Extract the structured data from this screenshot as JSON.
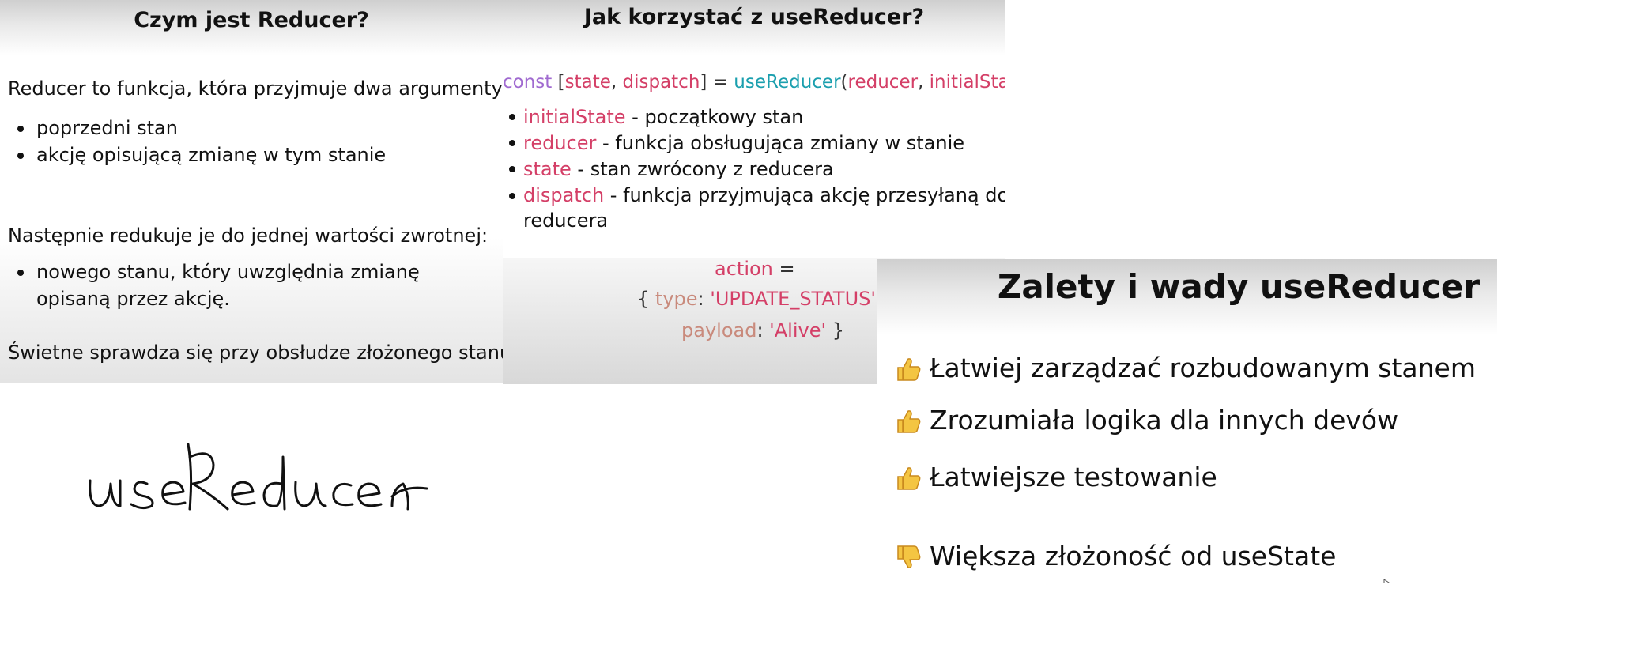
{
  "slide1": {
    "title": "Czym jest Reducer?",
    "intro": "Reducer to funkcja, która przyjmuje dwa argumenty:",
    "args": [
      "poprzedni stan",
      "akcję opisującą zmianę w tym stanie"
    ],
    "then": "Następnie redukuje je do jednej wartości zwrotnej:",
    "result_line1": "nowego stanu, który uwzględnia zmianę",
    "result_line2": "opisaną przez akcję.",
    "closing": "Świetne sprawdza się przy obsłudze złożonego stanu."
  },
  "handwriting": "useReducer",
  "slide2": {
    "title": "Jak korzystać z useReducer?",
    "code": {
      "const": "const",
      "open": "[",
      "state": "state",
      "comma1": ",",
      "dispatch": "dispatch",
      "close_eq": "] =",
      "fn": "useReducer",
      "paren_open": "(",
      "reducer": "reducer",
      "comma2": ",",
      "initialState": "initialState",
      "paren_close": ");"
    },
    "items": [
      {
        "term": "initialState",
        "desc": " - początkowy stan"
      },
      {
        "term": "reducer",
        "desc": " - funkcja obsługująca zmiany w stanie"
      },
      {
        "term": "state",
        "desc": " - stan zwrócony z reducera"
      },
      {
        "term": "dispatch",
        "desc": " - funkcja przyjmująca akcję przesyłaną do"
      }
    ],
    "item4_cont": "reducera",
    "action": {
      "name": "action",
      "eq": " =",
      "brace_open": "{ ",
      "type_key": "type",
      "colon1": ": ",
      "type_val": "'UPDATE_STATUS'",
      "comma": ",",
      "payload_key": "payload",
      "colon2": ": ",
      "payload_val": "'Alive'",
      "brace_close": " }"
    }
  },
  "slide3": {
    "title": "Zalety i wady useReducer",
    "pros": [
      "Łatwiej zarządzać rozbudowanym stanem",
      "Zrozumiała logika dla innych devów",
      "Łatwiejsze testowanie"
    ],
    "cons": [
      "Większa złożoność od useState"
    ],
    "icons": {
      "pro": "thumbs-up-icon",
      "con": "thumbs-down-icon"
    },
    "colors": {
      "thumb": "#f4c542",
      "thumb_edge": "#c98a1e"
    }
  }
}
